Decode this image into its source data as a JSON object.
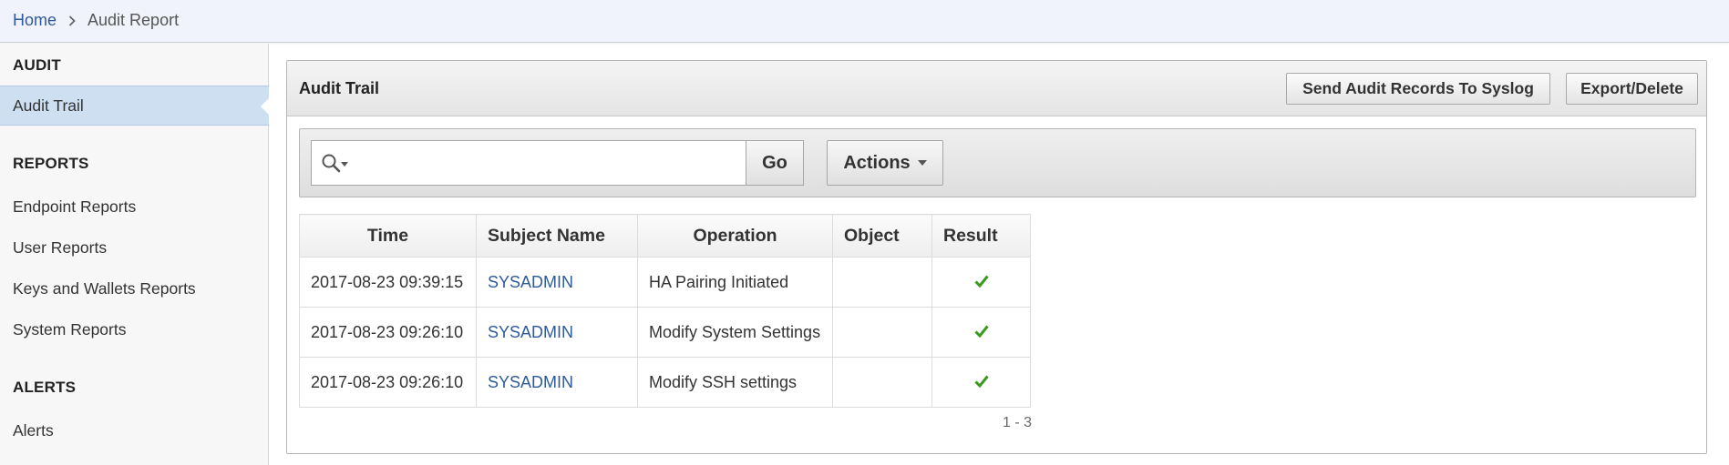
{
  "breadcrumb": {
    "home": "Home",
    "current": "Audit Report"
  },
  "sidebar": {
    "sections": [
      {
        "heading": "AUDIT",
        "items": [
          {
            "label": "Audit Trail",
            "active": true
          }
        ]
      },
      {
        "heading": "REPORTS",
        "items": [
          {
            "label": "Endpoint Reports"
          },
          {
            "label": "User Reports"
          },
          {
            "label": "Keys and Wallets Reports"
          },
          {
            "label": "System Reports"
          }
        ]
      },
      {
        "heading": "ALERTS",
        "items": [
          {
            "label": "Alerts"
          }
        ]
      }
    ]
  },
  "region": {
    "title": "Audit Trail",
    "buttons": {
      "syslog": "Send Audit Records To Syslog",
      "export": "Export/Delete"
    }
  },
  "toolbar": {
    "search_value": "",
    "go": "Go",
    "actions": "Actions"
  },
  "table": {
    "columns": [
      "Time",
      "Subject Name",
      "Operation",
      "Object",
      "Result"
    ],
    "rows": [
      {
        "time": "2017-08-23 09:39:15",
        "subject": "SYSADMIN",
        "operation": "HA Pairing Initiated",
        "object": "",
        "result": "success"
      },
      {
        "time": "2017-08-23 09:26:10",
        "subject": "SYSADMIN",
        "operation": "Modify System Settings",
        "object": "",
        "result": "success"
      },
      {
        "time": "2017-08-23 09:26:10",
        "subject": "SYSADMIN",
        "operation": "Modify SSH settings",
        "object": "",
        "result": "success"
      }
    ],
    "pagination": "1 - 3"
  },
  "colors": {
    "link": "#2f5a9b",
    "active_nav": "#cfdff2",
    "success_check": "#3a9a1f"
  },
  "icons": {
    "search": "search-icon",
    "breadcrumb_separator": "chevron-right-icon",
    "result": "checkmark-icon"
  }
}
